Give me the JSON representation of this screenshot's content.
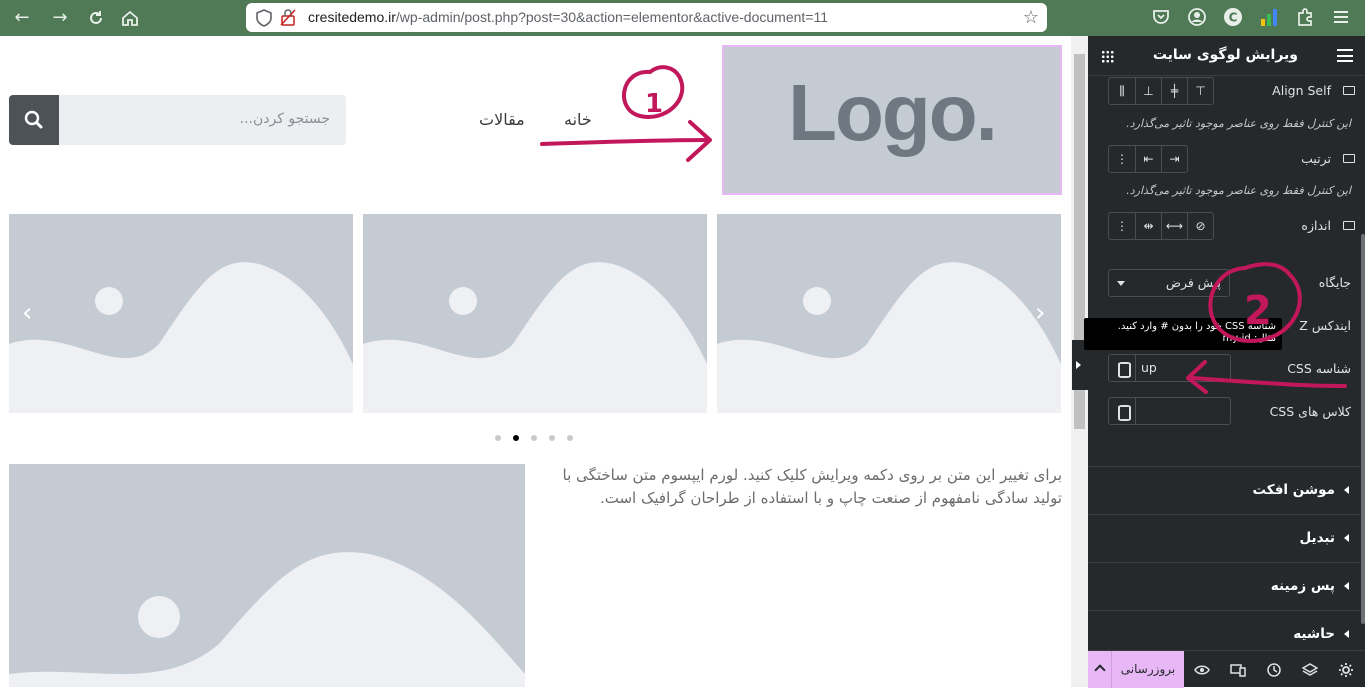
{
  "browser": {
    "url_domain": "cresitedemo.ir",
    "url_path": "/wp-admin/post.php?post=30&action=elementor&active-document=11"
  },
  "site": {
    "logo_text": "Logo.",
    "menu": [
      "خانه",
      "مقالات"
    ],
    "search_placeholder": "جستجو کردن...",
    "paragraph": "برای تغییر این متن بر روی دکمه ویرایش کلیک کنید. لورم ایپسوم متن ساختگی با تولید سادگی نامفهوم از صنعت چاپ و با استفاده از طراحان گرافیک است.",
    "carousel_dots": 5,
    "carousel_active_dot": 2
  },
  "panel": {
    "title": "ویرایش لوگوی سایت",
    "align_self_label": "Align Self",
    "note": "این کنترل فقط روی عناصر موجود تاثیر می‌گذارد.",
    "order_label": "ترتیب",
    "size_label": "اندازه",
    "position_label": "جایگاه",
    "position_value": "پیش فرض",
    "z_index_label": "ایندکس Z",
    "css_id_label": "شناسه CSS",
    "css_id_value": "up",
    "css_classes_label": "کلاس های CSS",
    "tooltip_line1": "شناسه CSS خود را بدون # وارد کنید.",
    "tooltip_line2": "مثال: my-id",
    "sections": [
      "موشن افکت",
      "تبدیل",
      "پس زمینه",
      "حاشیه"
    ],
    "update_label": "بروزرسانی"
  },
  "annotations": {
    "one": "1",
    "two": "2"
  },
  "colors": {
    "chrome": "#4f7a55",
    "panel_bg": "#26292c",
    "accent": "#e8b7f5",
    "annotation": "#c2185b",
    "placeholder_image": "#c5cbd3"
  }
}
